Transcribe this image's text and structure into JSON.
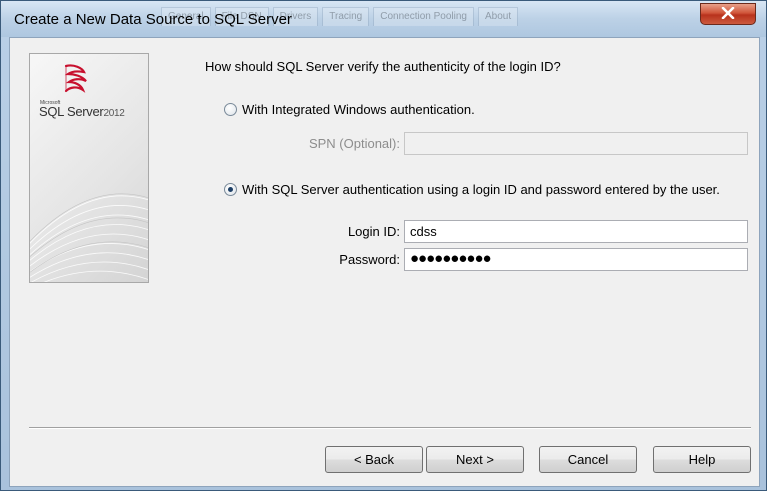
{
  "window": {
    "title": "Create a New Data Source to SQL Server",
    "background_tabs": [
      "General",
      "File DSN",
      "Drivers",
      "Tracing",
      "Connection Pooling",
      "About"
    ]
  },
  "branding": {
    "small_text": "Microsoft",
    "product": "SQL Server",
    "version": "2012"
  },
  "auth": {
    "question": "How should SQL Server verify the authenticity of the login ID?",
    "option_windows": {
      "label": "With Integrated Windows authentication.",
      "selected": false
    },
    "spn": {
      "label": "SPN (Optional):",
      "value": "",
      "disabled": true
    },
    "option_sql": {
      "label": "With SQL Server authentication using a login ID and password entered by the user.",
      "selected": true
    },
    "login": {
      "label": "Login ID:",
      "value": "cdss"
    },
    "password": {
      "label": "Password:",
      "masked_value": "●●●●●●●●●●"
    }
  },
  "buttons": {
    "back": "< Back",
    "next": "Next >",
    "cancel": "Cancel",
    "help": "Help"
  },
  "colors": {
    "title_bar": "#b9cfe6",
    "close_button": "#c9472e",
    "dialog_background": "#f0f0f0",
    "brand_red": "#c8102e"
  },
  "icons": {
    "close": "close-x-icon",
    "logo": "sql-server-logo-icon"
  }
}
